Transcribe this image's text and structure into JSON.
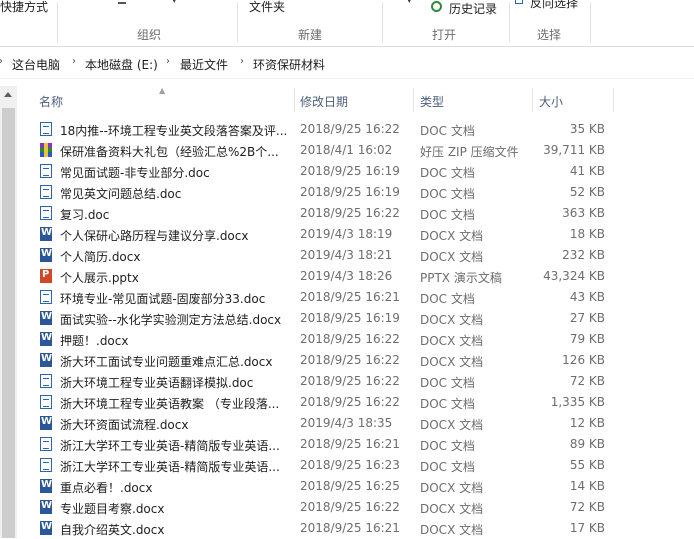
{
  "ribbon": {
    "quick_access_fragment": "快捷方式",
    "organize_caption": "组织",
    "new_item_fragment": "文件夹",
    "new_caption": "新建",
    "history_label": "历史记录",
    "open_caption": "打开",
    "select_fragment": "反向选择",
    "select_caption": "选择"
  },
  "address": {
    "crumbs": [
      "这台电脑",
      "本地磁盘 (E:)",
      "最近文件",
      "环资保研材料"
    ]
  },
  "columns": {
    "name": "名称",
    "date": "修改日期",
    "type": "类型",
    "size": "大小"
  },
  "files": [
    {
      "icon": "doc",
      "name": "18内推--环境工程专业英文段落答案及评...",
      "date": "2018/9/25 16:22",
      "type": "DOC 文档",
      "size": "35 KB"
    },
    {
      "icon": "zip",
      "name": "保研准备资料大礼包（经验汇总%2B个...",
      "date": "2018/4/1 16:02",
      "type": "好压 ZIP 压缩文件",
      "size": "39,711 KB"
    },
    {
      "icon": "doc",
      "name": "常见面试题-非专业部分.doc",
      "date": "2018/9/25 16:19",
      "type": "DOC 文档",
      "size": "41 KB"
    },
    {
      "icon": "doc",
      "name": "常见英文问题总结.doc",
      "date": "2018/9/25 16:19",
      "type": "DOC 文档",
      "size": "52 KB"
    },
    {
      "icon": "doc",
      "name": "复习.doc",
      "date": "2018/9/25 16:22",
      "type": "DOC 文档",
      "size": "363 KB"
    },
    {
      "icon": "docx",
      "name": "个人保研心路历程与建议分享.docx",
      "date": "2019/4/3 18:19",
      "type": "DOCX 文档",
      "size": "18 KB"
    },
    {
      "icon": "docx",
      "name": "个人简历.docx",
      "date": "2019/4/3 18:21",
      "type": "DOCX 文档",
      "size": "232 KB"
    },
    {
      "icon": "pptx",
      "name": "个人展示.pptx",
      "date": "2019/4/3 18:26",
      "type": "PPTX 演示文稿",
      "size": "43,324 KB"
    },
    {
      "icon": "doc",
      "name": "环境专业-常见面试题-固废部分33.doc",
      "date": "2018/9/25 16:21",
      "type": "DOC 文档",
      "size": "43 KB"
    },
    {
      "icon": "docx",
      "name": "面试实验--水化学实验测定方法总结.docx",
      "date": "2018/9/25 16:19",
      "type": "DOCX 文档",
      "size": "27 KB"
    },
    {
      "icon": "docx",
      "name": "押题！.docx",
      "date": "2018/9/25 16:22",
      "type": "DOCX 文档",
      "size": "79 KB"
    },
    {
      "icon": "docx",
      "name": "浙大环工面试专业问题重难点汇总.docx",
      "date": "2018/9/25 16:22",
      "type": "DOCX 文档",
      "size": "126 KB"
    },
    {
      "icon": "doc",
      "name": "浙大环境工程专业英语翻译模拟.doc",
      "date": "2018/9/25 16:22",
      "type": "DOC 文档",
      "size": "72 KB"
    },
    {
      "icon": "doc",
      "name": "浙大环境工程专业英语教案 （专业段落...",
      "date": "2018/9/25 16:22",
      "type": "DOC 文档",
      "size": "1,335 KB"
    },
    {
      "icon": "docx",
      "name": "浙大环资面试流程.docx",
      "date": "2019/4/3 18:35",
      "type": "DOCX 文档",
      "size": "12 KB"
    },
    {
      "icon": "doc",
      "name": "浙江大学环工专业英语-精简版专业英语...",
      "date": "2018/9/25 16:21",
      "type": "DOC 文档",
      "size": "89 KB"
    },
    {
      "icon": "doc",
      "name": "浙江大学环工专业英语-精简版专业英语...",
      "date": "2018/9/25 16:23",
      "type": "DOC 文档",
      "size": "55 KB"
    },
    {
      "icon": "docx",
      "name": "重点必看！.docx",
      "date": "2018/9/25 16:25",
      "type": "DOCX 文档",
      "size": "14 KB"
    },
    {
      "icon": "docx",
      "name": "专业题目考察.docx",
      "date": "2018/9/25 16:22",
      "type": "DOCX 文档",
      "size": "72 KB"
    },
    {
      "icon": "docx",
      "name": "自我介绍英文.docx",
      "date": "2018/9/25 16:21",
      "type": "DOCX 文档",
      "size": "17 KB"
    }
  ]
}
